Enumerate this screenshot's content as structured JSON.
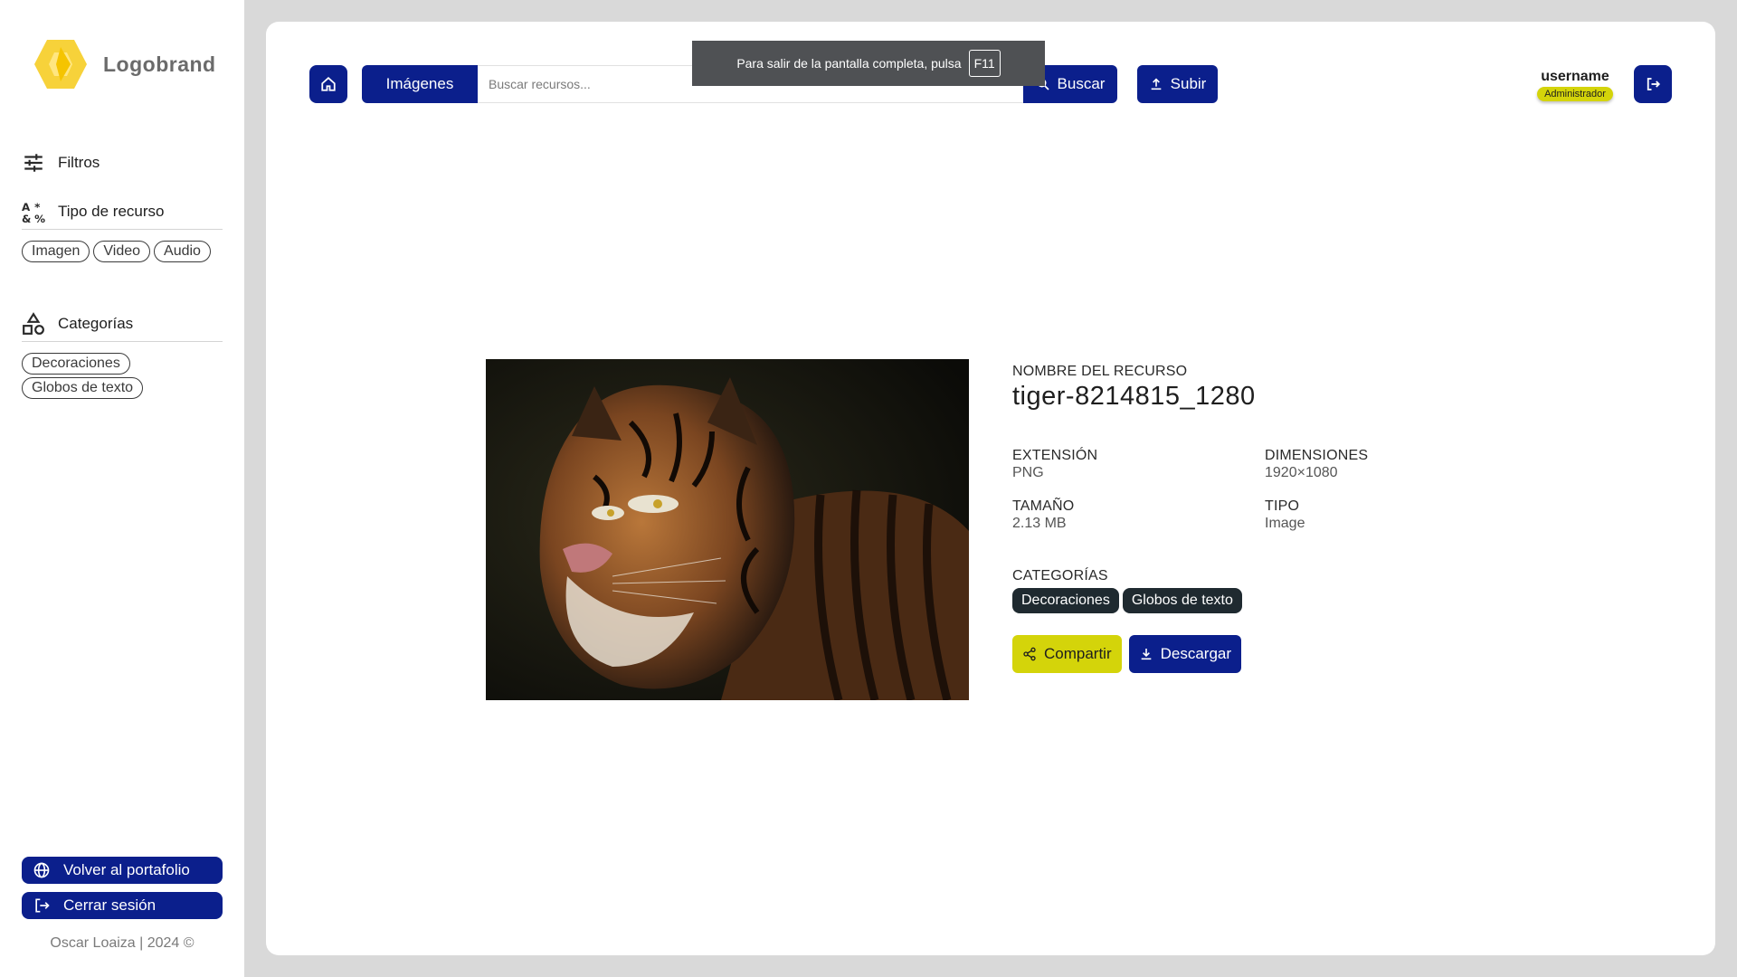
{
  "brand": {
    "name": "Logobrand",
    "logo_color": "#f7d23a"
  },
  "sidebar": {
    "filters_label": "Filtros",
    "resource_type": {
      "label": "Tipo de recurso",
      "options": [
        "Imagen",
        "Video",
        "Audio"
      ]
    },
    "categories": {
      "label": "Categorías",
      "options": [
        "Decoraciones",
        "Globos de texto"
      ]
    },
    "back_button": "Volver al portafolio",
    "logout_button": "Cerrar sesión",
    "copyright": "Oscar Loaiza | 2024 ©"
  },
  "topbar": {
    "search_category": "Imágenes",
    "search_placeholder": "Buscar recursos...",
    "search_button": "Buscar",
    "upload_button": "Subir",
    "fullscreen_notice": "Para salir de la pantalla completa, pulsa",
    "fullscreen_key": "F11",
    "user": {
      "name": "username",
      "role": "Administrador"
    }
  },
  "resource": {
    "name_label": "NOMBRE DEL RECURSO",
    "name": "tiger-8214815_1280",
    "extension_label": "EXTENSIÓN",
    "extension": "PNG",
    "dimensions_label": "DIMENSIONES",
    "dimensions": "1920×1080",
    "size_label": "TAMAÑO",
    "size": "2.13 MB",
    "type_label": "TIPO",
    "type": "Image",
    "categories_label": "CATEGORÍAS",
    "categories": [
      "Decoraciones",
      "Globos de texto"
    ],
    "share_button": "Compartir",
    "download_button": "Descargar"
  },
  "colors": {
    "primary": "#0b1f8c",
    "accent": "#d4d40a",
    "pill_dark": "#1f2a30",
    "background": "#d9d9d9"
  }
}
